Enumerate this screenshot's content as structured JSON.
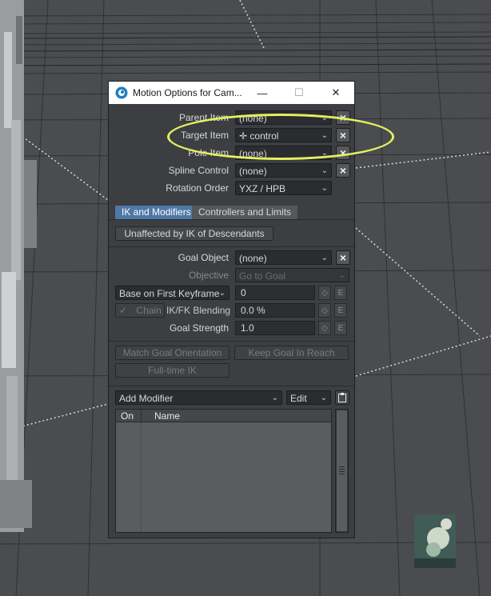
{
  "dialog": {
    "title": "Motion Options for Cam...",
    "minimize": "—",
    "maximize": "☐",
    "close": "✕"
  },
  "fields": {
    "parent_item": {
      "label": "Parent Item",
      "value": "(none)"
    },
    "target_item": {
      "label": "Target Item",
      "value": "control"
    },
    "pole_item": {
      "label": "Pole Item",
      "value": "(none)"
    },
    "spline_control": {
      "label": "Spline Control",
      "value": "(none)"
    },
    "rotation_order": {
      "label": "Rotation Order",
      "value": "YXZ / HPB"
    }
  },
  "tabs": [
    {
      "label": "IK and Modifiers",
      "active": true
    },
    {
      "label": "Controllers and Limits",
      "active": false
    }
  ],
  "ik": {
    "unaffected_button": "Unaffected by IK of Descendants",
    "goal_object": {
      "label": "Goal Object",
      "value": "(none)"
    },
    "objective": {
      "label": "Objective",
      "value": "Go to Goal"
    },
    "base_on": {
      "value": "Base on First Keyframe",
      "field": "0"
    },
    "chain_label": "Chain",
    "blending": {
      "label": "IK/FK Blending",
      "value": "0.0 %"
    },
    "goal_strength": {
      "label": "Goal Strength",
      "value": "1.0"
    },
    "match_goal_orientation": "Match Goal Orientation",
    "keep_goal_in_reach": "Keep Goal In Reach",
    "full_time_ik": "Full-time IK",
    "envelope_label": "E",
    "link_label": "◇"
  },
  "modifiers": {
    "add_modifier": "Add Modifier",
    "edit": "Edit",
    "columns": [
      "On",
      "Name"
    ]
  },
  "colors": {
    "annotation": "#e4ef60",
    "tab_active": "#4f78a6"
  }
}
